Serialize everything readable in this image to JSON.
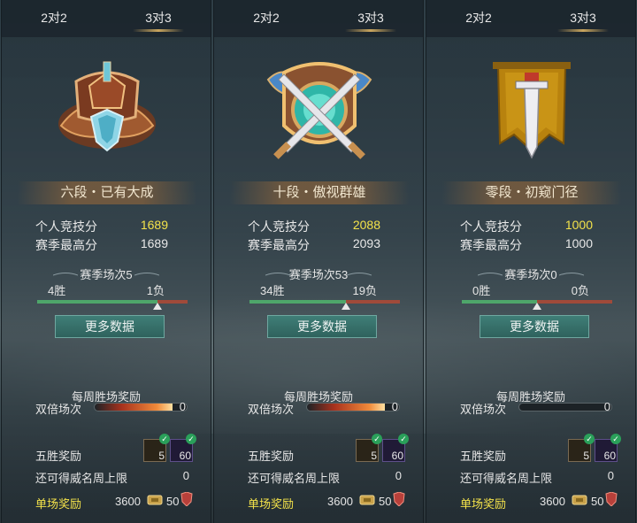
{
  "panels": [
    {
      "tabs": [
        "2对2",
        "3对3"
      ],
      "active_tab": 1,
      "emblem": "bronze-winged-helmet-emblem",
      "rank": "六段・已有大成",
      "personal_score_label": "个人竞技分",
      "personal_score": "1689",
      "season_best_label": "赛季最高分",
      "season_best": "1689",
      "season_matches": "赛季场次5",
      "wins": "4胜",
      "losses": "1负",
      "win_ratio": 0.8,
      "more_data": "更多数据",
      "weekly_reward_title": "每周胜场奖励",
      "double_label": "双倍场次",
      "double_count": "0",
      "double_glow": 0.85,
      "five_win_label": "五胜奖励",
      "reward1_count": "5",
      "reward2_count": "60",
      "cap_label": "还可得威名周上限",
      "cap_value": "0",
      "single_label": "单场奖励",
      "single_coin": "3600",
      "single_honor": "50"
    },
    {
      "tabs": [
        "2对2",
        "3对3"
      ],
      "active_tab": 1,
      "emblem": "crossed-swords-jade-shield-emblem",
      "rank": "十段・傲视群雄",
      "personal_score_label": "个人竞技分",
      "personal_score": "2088",
      "season_best_label": "赛季最高分",
      "season_best": "2093",
      "season_matches": "赛季场次53",
      "wins": "34胜",
      "losses": "19负",
      "win_ratio": 0.64,
      "more_data": "更多数据",
      "weekly_reward_title": "每周胜场奖励",
      "double_label": "双倍场次",
      "double_count": "0",
      "double_glow": 0.85,
      "five_win_label": "五胜奖励",
      "reward1_count": "5",
      "reward2_count": "60",
      "cap_label": "还可得威名周上限",
      "cap_value": "0",
      "single_label": "单场奖励",
      "single_coin": "3600",
      "single_honor": "50"
    },
    {
      "tabs": [
        "2对2",
        "3对3"
      ],
      "active_tab": 1,
      "emblem": "golden-banner-sword-emblem",
      "rank": "零段・初窥门径",
      "personal_score_label": "个人竞技分",
      "personal_score": "1000",
      "season_best_label": "赛季最高分",
      "season_best": "1000",
      "season_matches": "赛季场次0",
      "wins": "0胜",
      "losses": "0负",
      "win_ratio": 0.5,
      "more_data": "更多数据",
      "weekly_reward_title": "每周胜场奖励",
      "double_label": "双倍场次",
      "double_count": "0",
      "double_glow": 0,
      "five_win_label": "五胜奖励",
      "reward1_count": "5",
      "reward2_count": "60",
      "cap_label": "还可得威名周上限",
      "cap_value": "0",
      "single_label": "单场奖励",
      "single_coin": "3600",
      "single_honor": "50"
    }
  ],
  "colors": {
    "highlight": "#f3e24a",
    "win_bar": "#4ea66a",
    "loss_bar": "#a04a3a",
    "button": "#3f7e77"
  }
}
